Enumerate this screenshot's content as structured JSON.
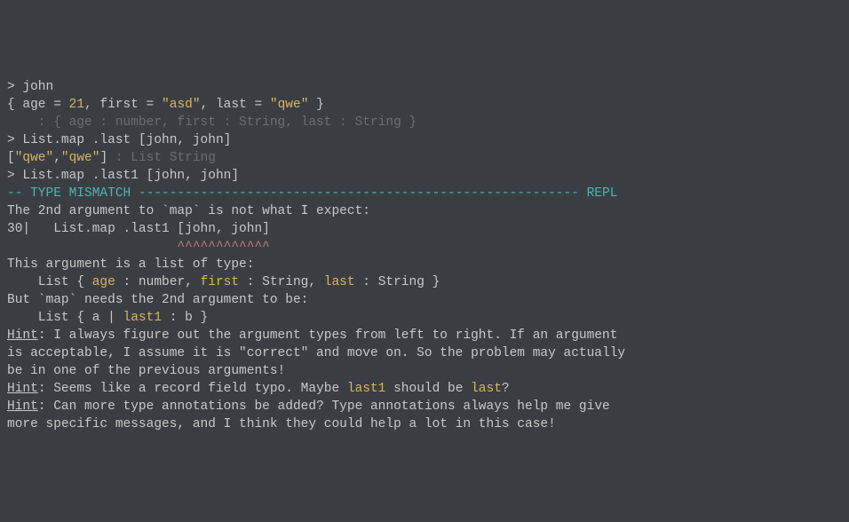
{
  "repl": {
    "line1": "> john",
    "line2a": "{ age = ",
    "line2b": "21",
    "line2c": ", first = ",
    "line2d": "\"asd\"",
    "line2e": ", last = ",
    "line2f": "\"qwe\"",
    "line2g": " }",
    "line3": "    : { age : number, first : String, last : String }",
    "line4": "> List.map .last [john, john]",
    "line5a": "[",
    "line5b": "\"qwe\"",
    "line5c": ",",
    "line5d": "\"qwe\"",
    "line5e": "]",
    "line5f": " : List String",
    "line6": "> List.map .last1 [john, john]",
    "errHeader": "-- TYPE MISMATCH --------------------------------------------------------- REPL",
    "blank": "",
    "err1": "The 2nd argument to `map` is not what I expect:",
    "sourceLine": "30|   List.map .last1 [john, john]",
    "sourceCaret": "                      ^^^^^^^^^^^^",
    "err2": "This argument is a list of type:",
    "type1a": "    List { ",
    "type1b": "age",
    "type1c": " : number, ",
    "type1d": "first",
    "type1e": " : String, ",
    "type1f": "last",
    "type1g": " : String }",
    "err3": "But `map` needs the 2nd argument to be:",
    "type2a": "    List { a | ",
    "type2b": "last1",
    "type2c": " : b }",
    "hintLabel": "Hint",
    "hint1a": ": I always figure out the argument types from left to right. If an argument",
    "hint1b": "is acceptable, I assume it is \"correct\" and move on. So the problem may actually",
    "hint1c": "be in one of the previous arguments!",
    "hint2a": ": Seems like a record field typo. Maybe ",
    "hint2b": "last1",
    "hint2c": " should be ",
    "hint2d": "last",
    "hint2e": "?",
    "hint3a": ": Can more type annotations be added? Type annotations always help me give",
    "hint3b": "more specific messages, and I think they could help a lot in this case!"
  }
}
